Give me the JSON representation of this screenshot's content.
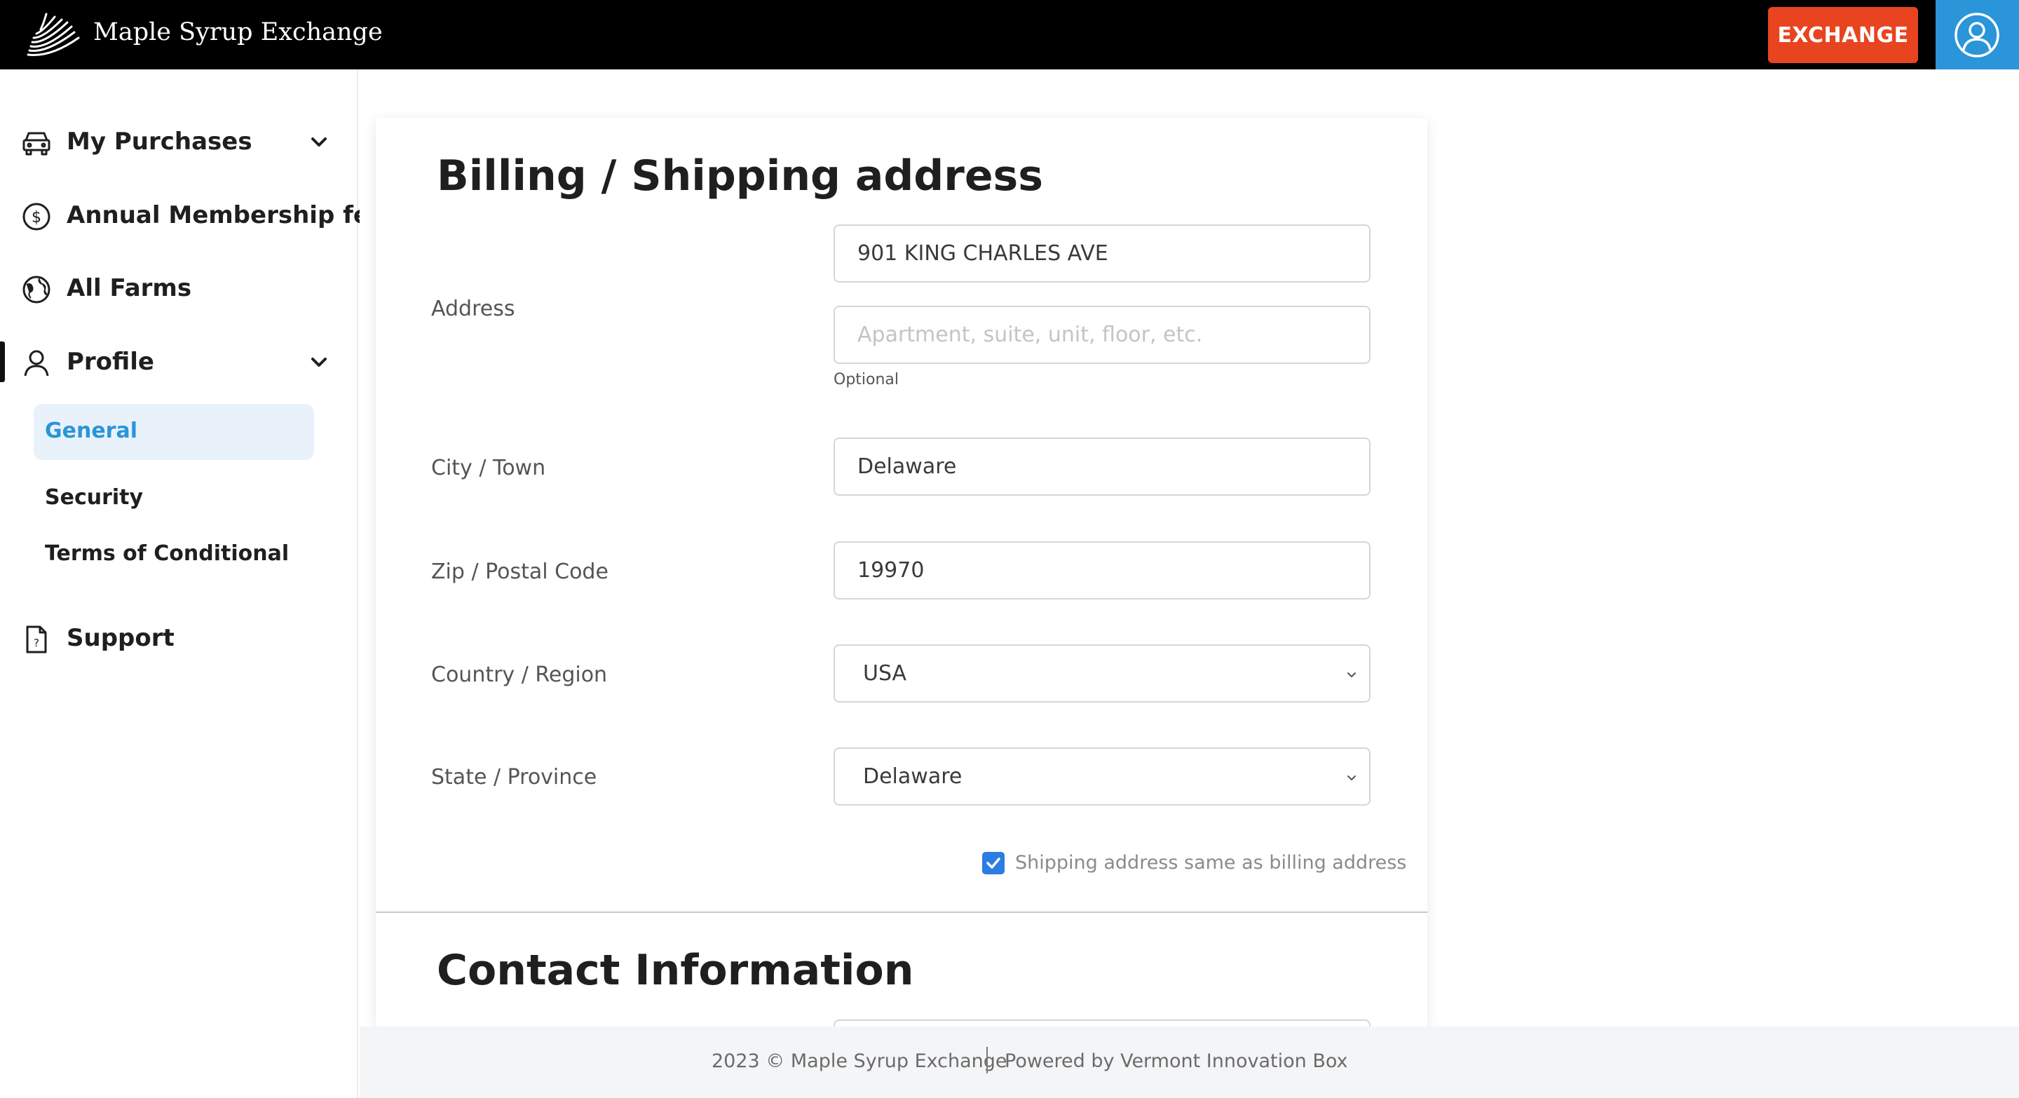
{
  "header": {
    "brand": "Maple Syrup Exchange",
    "logo_icon": "maple-leaf-logo",
    "exchange_label": "EXCHANGE",
    "user_icon": "user-circle-icon",
    "colors": {
      "bar": "#000000",
      "exchange_button": "#e8441f",
      "user_button": "#2a95d8"
    }
  },
  "sidebar": {
    "items": [
      {
        "label": "My Purchases",
        "icon": "car-icon",
        "expandable": true
      },
      {
        "label": "Annual Membership fee",
        "icon": "dollar-circle-icon",
        "expandable": false
      },
      {
        "label": "All Farms",
        "icon": "globe-icon",
        "expandable": false
      },
      {
        "label": "Profile",
        "icon": "user-icon",
        "expandable": true,
        "active": true
      },
      {
        "label": "Support",
        "icon": "help-document-icon",
        "expandable": false
      }
    ],
    "profile_subitems": [
      {
        "label": "General",
        "active": true
      },
      {
        "label": "Security",
        "active": false
      },
      {
        "label": "Terms of Conditional",
        "active": false
      }
    ],
    "accent_color": "#2a95d8"
  },
  "billing": {
    "title": "Billing / Shipping address",
    "address_label": "Address",
    "address_value": "901 KING CHARLES AVE",
    "address2_placeholder": "Apartment, suite, unit, floor, etc.",
    "address2_hint": "Optional",
    "city_label": "City / Town",
    "city_value": "Delaware",
    "zip_label": "Zip / Postal Code",
    "zip_value": "19970",
    "country_label": "Country / Region",
    "country_value": "USA",
    "state_label": "State / Province",
    "state_value": "Delaware",
    "same_as_billing_label": "Shipping address same as billing address",
    "same_as_billing_checked": true
  },
  "contact": {
    "title": "Contact Information"
  },
  "footer": {
    "copyright": "2023 © Maple Syrup Exchange",
    "powered_by": "Powered by Vermont Innovation Box"
  }
}
